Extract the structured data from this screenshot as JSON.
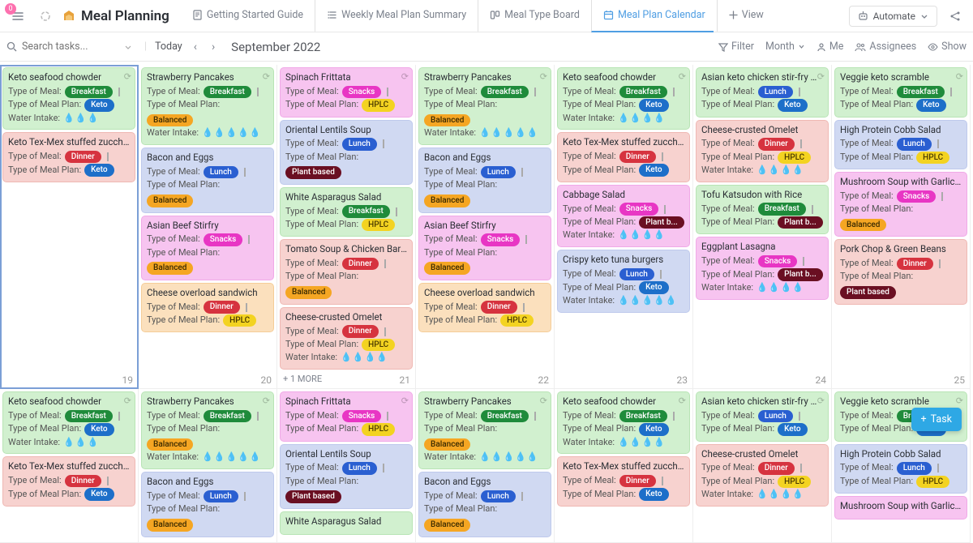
{
  "header": {
    "title": "Meal Planning",
    "tabs": [
      {
        "label": "Getting Started Guide",
        "icon": "doc"
      },
      {
        "label": "Weekly Meal Plan Summary",
        "icon": "list"
      },
      {
        "label": "Meal Type Board",
        "icon": "board"
      },
      {
        "label": "Meal Plan Calendar",
        "icon": "calendar",
        "active": true
      },
      {
        "label": "View",
        "icon": "plus"
      }
    ],
    "automate": "Automate",
    "notification_count": "0"
  },
  "toolbar": {
    "search_placeholder": "Search tasks...",
    "today": "Today",
    "month_label": "September 2022",
    "filter": "Filter",
    "month_btn": "Month",
    "me": "Me",
    "assignees": "Assignees",
    "show": "Show"
  },
  "labels": {
    "type_of_meal": "Type of Meal:",
    "type_of_meal_plan": "Type of Meal Plan:",
    "water_intake": "Water Intake:",
    "more": "+ 1 MORE",
    "add_task": "Task"
  },
  "meal_tags": {
    "breakfast": "Breakfast",
    "lunch": "Lunch",
    "dinner": "Dinner",
    "snacks": "Snacks"
  },
  "plan_tags": {
    "keto": "Keto",
    "balanced": "Balanced",
    "hplc": "HPLC",
    "plant": "Plant based",
    "plant_short": "Plant b..."
  },
  "days": [
    {
      "num": "19",
      "selected": true,
      "cards": [
        {
          "bg": "green",
          "title": "Keto seafood chowder",
          "meal": "breakfast",
          "plan": "keto",
          "water": 3,
          "sync": true
        },
        {
          "bg": "red",
          "title": "Keto Tex-Mex stuffed zucchini boat",
          "meal": "dinner",
          "plan": "keto"
        }
      ]
    },
    {
      "num": "20",
      "cards": [
        {
          "bg": "green",
          "title": "Strawberry Pancakes",
          "meal": "breakfast",
          "plan": "balanced",
          "water": 5,
          "sync": true
        },
        {
          "bg": "blue",
          "title": "Bacon and Eggs",
          "meal": "lunch",
          "plan": "balanced"
        },
        {
          "bg": "pink",
          "title": "Asian Beef Stirfry",
          "meal": "snacks",
          "plan": "balanced"
        },
        {
          "bg": "orange",
          "title": "Cheese overload sandwich",
          "meal": "dinner",
          "plan": "hplc"
        }
      ]
    },
    {
      "num": "21",
      "more": true,
      "cards": [
        {
          "bg": "pink",
          "title": "Spinach Frittata",
          "meal": "snacks",
          "plan": "hplc",
          "sync": true
        },
        {
          "bg": "blue",
          "title": "Oriental Lentils Soup",
          "meal": "lunch",
          "plan": "plant"
        },
        {
          "bg": "green",
          "title": "White Asparagus Salad",
          "meal": "breakfast",
          "plan": "hplc"
        },
        {
          "bg": "red",
          "title": "Tomato Soup & Chicken Barbecue",
          "meal": "dinner",
          "plan": "balanced"
        },
        {
          "bg": "red",
          "title": "Cheese-crusted Omelet",
          "meal": "dinner",
          "plan": "hplc",
          "water": 4
        }
      ]
    },
    {
      "num": "22",
      "cards": [
        {
          "bg": "green",
          "title": "Strawberry Pancakes",
          "meal": "breakfast",
          "plan": "balanced",
          "water": 5,
          "sync": true
        },
        {
          "bg": "blue",
          "title": "Bacon and Eggs",
          "meal": "lunch",
          "plan": "balanced"
        },
        {
          "bg": "pink",
          "title": "Asian Beef Stirfry",
          "meal": "snacks",
          "plan": "balanced"
        },
        {
          "bg": "orange",
          "title": "Cheese overload sandwich",
          "meal": "dinner",
          "plan": "hplc"
        }
      ]
    },
    {
      "num": "23",
      "cards": [
        {
          "bg": "green",
          "title": "Keto seafood chowder",
          "meal": "breakfast",
          "plan": "keto",
          "water": 4,
          "sync": true
        },
        {
          "bg": "red",
          "title": "Keto Tex-Mex stuffed zucchini bo",
          "meal": "dinner",
          "plan": "keto"
        },
        {
          "bg": "pink",
          "title": "Cabbage Salad",
          "meal": "snacks",
          "plan": "plant_short",
          "water": 4
        },
        {
          "bg": "blue",
          "title": "Crispy keto tuna burgers",
          "meal": "lunch",
          "plan": "keto",
          "water": 5
        }
      ]
    },
    {
      "num": "24",
      "cards": [
        {
          "bg": "green",
          "title": "Asian keto chicken stir-fry with broc",
          "meal": "lunch",
          "plan": "keto",
          "sync": true
        },
        {
          "bg": "red",
          "title": "Cheese-crusted Omelet",
          "meal": "dinner",
          "plan": "hplc",
          "water": 4
        },
        {
          "bg": "green",
          "title": "Tofu Katsudon with Rice",
          "meal": "breakfast",
          "plan": "plant_short"
        },
        {
          "bg": "pink",
          "title": "Eggplant Lasagna",
          "meal": "snacks",
          "plan": "plant_short",
          "water": 4
        }
      ]
    },
    {
      "num": "25",
      "cards": [
        {
          "bg": "green",
          "title": "Veggie keto scramble",
          "meal": "breakfast",
          "plan": "keto",
          "sync": true
        },
        {
          "bg": "blue",
          "title": "High Protein Cobb Salad",
          "meal": "lunch",
          "plan": "hplc"
        },
        {
          "bg": "pink",
          "title": "Mushroom Soup with Garlic Bre",
          "meal": "snacks",
          "plan": "balanced"
        },
        {
          "bg": "red",
          "title": "Pork Chop & Green Beans",
          "meal": "dinner",
          "plan": "plant"
        }
      ]
    },
    {
      "num": "",
      "cards": [
        {
          "bg": "green",
          "title": "Keto seafood chowder",
          "meal": "breakfast",
          "plan": "keto",
          "water": 3,
          "sync": true
        },
        {
          "bg": "red",
          "title": "Keto Tex-Mex stuffed zucchini bo",
          "meal": "dinner",
          "plan": "keto"
        }
      ]
    },
    {
      "num": "",
      "cards": [
        {
          "bg": "green",
          "title": "Strawberry Pancakes",
          "meal": "breakfast",
          "plan": "balanced",
          "water": 5,
          "sync": true
        },
        {
          "bg": "blue",
          "title": "Bacon and Eggs",
          "meal": "lunch",
          "plan": "balanced"
        }
      ]
    },
    {
      "num": "",
      "cards": [
        {
          "bg": "pink",
          "title": "Spinach Frittata",
          "meal": "snacks",
          "plan": "hplc",
          "sync": true
        },
        {
          "bg": "blue",
          "title": "Oriental Lentils Soup",
          "meal": "lunch",
          "plan": "plant"
        },
        {
          "bg": "green",
          "title": "White Asparagus Salad"
        }
      ]
    },
    {
      "num": "",
      "cards": [
        {
          "bg": "green",
          "title": "Strawberry Pancakes",
          "meal": "breakfast",
          "plan": "balanced",
          "water": 5,
          "sync": true
        },
        {
          "bg": "blue",
          "title": "Bacon and Eggs",
          "meal": "lunch",
          "plan": "balanced"
        }
      ]
    },
    {
      "num": "",
      "cards": [
        {
          "bg": "green",
          "title": "Keto seafood chowder",
          "meal": "breakfast",
          "plan": "keto",
          "water": 4,
          "sync": true
        },
        {
          "bg": "red",
          "title": "Keto Tex-Mex stuffed zucchini bo",
          "meal": "dinner",
          "plan": "keto"
        }
      ]
    },
    {
      "num": "",
      "cards": [
        {
          "bg": "green",
          "title": "Asian keto chicken stir-fry with th",
          "meal": "lunch",
          "plan": "keto",
          "sync": true
        },
        {
          "bg": "red",
          "title": "Cheese-crusted Omelet",
          "meal": "dinner",
          "plan": "hplc",
          "water": 4
        }
      ]
    },
    {
      "num": "",
      "cards": [
        {
          "bg": "green",
          "title": "Veggie keto scramble",
          "meal": "breakfast",
          "plan": "keto",
          "sync": true
        },
        {
          "bg": "blue",
          "title": "High Protein Cobb Salad",
          "meal": "lunch",
          "plan": "hplc"
        },
        {
          "bg": "pink",
          "title": "Mushroom Soup with Garlic Bre"
        }
      ]
    }
  ]
}
